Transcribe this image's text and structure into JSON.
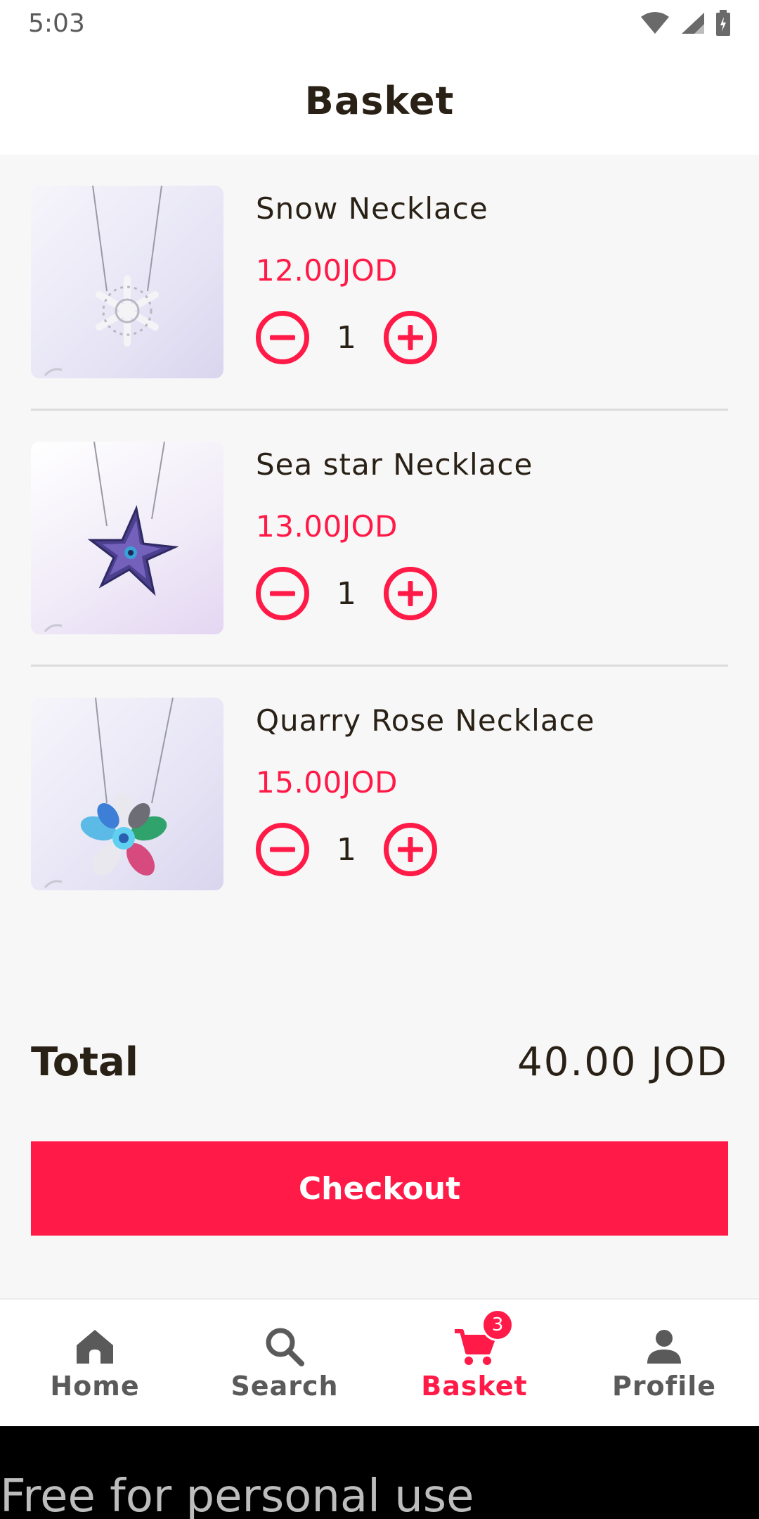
{
  "status_bar": {
    "time": "5:03"
  },
  "header": {
    "title": "Basket"
  },
  "items": [
    {
      "name": "Snow Necklace",
      "price": "12.00JOD",
      "quantity": "1",
      "pendant": "snowflake"
    },
    {
      "name": "Sea star Necklace",
      "price": "13.00JOD",
      "quantity": "1",
      "pendant": "starfish"
    },
    {
      "name": "Quarry Rose Necklace",
      "price": "15.00JOD",
      "quantity": "1",
      "pendant": "flower"
    }
  ],
  "total": {
    "label": "Total",
    "value": "40.00 JOD"
  },
  "checkout": {
    "label": "Checkout"
  },
  "nav": {
    "items": [
      {
        "label": "Home",
        "icon": "home-icon",
        "active": false
      },
      {
        "label": "Search",
        "icon": "search-icon",
        "active": false
      },
      {
        "label": "Basket",
        "icon": "cart-icon",
        "active": true,
        "badge": "3"
      },
      {
        "label": "Profile",
        "icon": "person-icon",
        "active": false
      }
    ]
  },
  "watermark": {
    "text": "Free for personal use"
  },
  "colors": {
    "accent": "#ff1a48",
    "text": "#2a2116",
    "background": "#f7f7f7"
  }
}
